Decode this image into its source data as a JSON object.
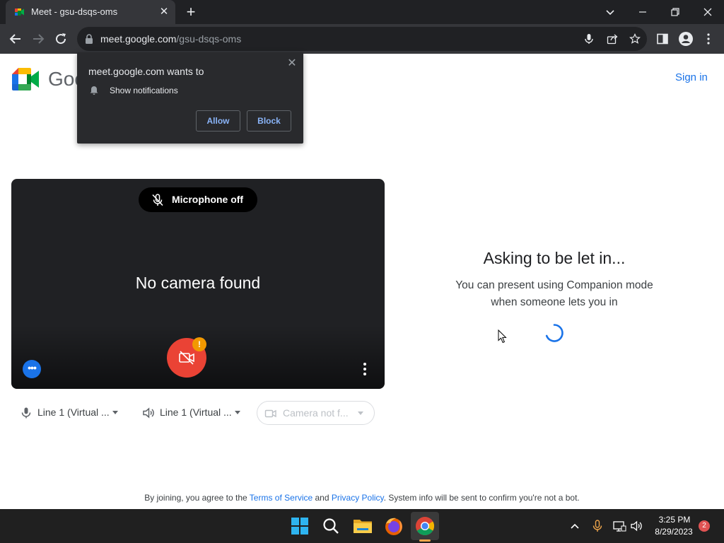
{
  "browser": {
    "tab_title": "Meet - gsu-dsqs-oms",
    "url_host": "meet.google.com",
    "url_path": "/gsu-dsqs-oms"
  },
  "notification_popup": {
    "title": "meet.google.com wants to",
    "permission": "Show notifications",
    "allow_label": "Allow",
    "block_label": "Block"
  },
  "header": {
    "logo_text": "Goo",
    "sign_in_label": "Sign in"
  },
  "video_tile": {
    "mic_status": "Microphone off",
    "camera_status": "No camera found",
    "warning_mark": "!"
  },
  "devices": {
    "microphone": "Line 1 (Virtual ...",
    "speaker": "Line 1 (Virtual ...",
    "camera": "Camera not f..."
  },
  "join_panel": {
    "title": "Asking to be let in...",
    "subtitle_line1": "You can present using Companion mode",
    "subtitle_line2": "when someone lets you in"
  },
  "footer": {
    "text_before": "By joining, you agree to the",
    "terms_link": "Terms of Service",
    "and_text": "and",
    "privacy_link": "Privacy Policy",
    "text_after": ". System info will be sent to confirm you're not a bot."
  },
  "taskbar": {
    "time": "3:25 PM",
    "date": "8/29/2023",
    "notification_count": "2"
  },
  "colors": {
    "accent_blue": "#1a73e8",
    "camera_off_red": "#ea4335",
    "warning_orange": "#f29900"
  }
}
